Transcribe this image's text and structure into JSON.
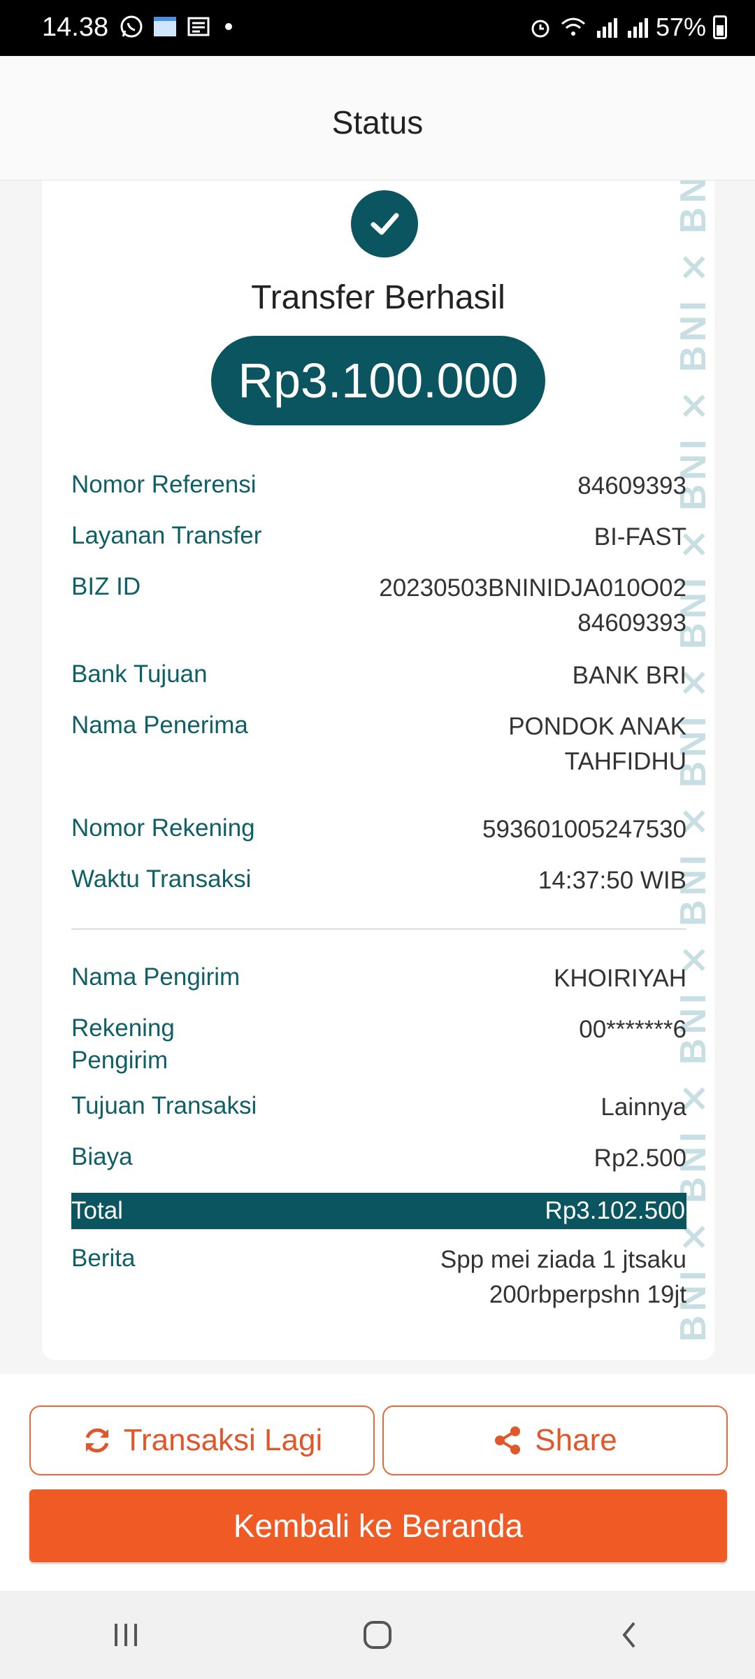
{
  "status_bar": {
    "time": "14.38",
    "battery": "57%",
    "left_icons": [
      "whatsapp-icon",
      "bima-icon",
      "news-icon"
    ],
    "right_icons": [
      "alarm-icon",
      "wifi-icon",
      "signal-icon",
      "signal-icon"
    ]
  },
  "header": {
    "title": "Status"
  },
  "receipt": {
    "title": "Transfer Berhasil",
    "amount": "Rp3.100.000",
    "watermark": "BNI",
    "details": [
      {
        "label": "Nomor Referensi",
        "value": "84609393"
      },
      {
        "label": "Layanan Transfer",
        "value": "BI-FAST"
      },
      {
        "label": "BIZ ID",
        "value": "20230503BNINIDJA010O02\n84609393"
      },
      {
        "label": "Bank Tujuan",
        "value": "BANK BRI"
      },
      {
        "label": "Nama Penerima",
        "value": "PONDOK ANAK\nTAHFIDHU"
      },
      {
        "label": "Nomor Rekening",
        "value": "593601005247530"
      },
      {
        "label": "Waktu Transaksi",
        "value": "14:37:50 WIB"
      }
    ],
    "sender": [
      {
        "label": "Nama Pengirim",
        "value": "KHOIRIYAH"
      },
      {
        "label": "Rekening\nPengirim",
        "value": "00*******6"
      },
      {
        "label": "Tujuan Transaksi",
        "value": "Lainnya"
      },
      {
        "label": "Biaya",
        "value": "Rp2.500"
      }
    ],
    "total": {
      "label": "Total",
      "value": "Rp3.102.500"
    },
    "note": {
      "label": "Berita",
      "value": "Spp mei ziada 1 jtsaku\n200rbperpshn 19jt"
    }
  },
  "actions": {
    "repeat_label": "Transaksi Lagi",
    "share_label": "Share",
    "home_label": "Kembali ke Beranda"
  },
  "colors": {
    "primary": "#0b5560",
    "accent": "#f05a24",
    "label": "#0f5f66"
  }
}
